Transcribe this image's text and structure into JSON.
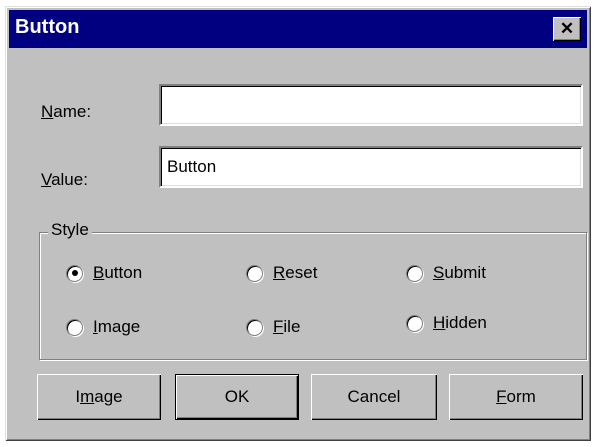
{
  "window": {
    "title": "Button",
    "close_glyph": "✕"
  },
  "form": {
    "name_label_mnemonic": "N",
    "name_label_rest": "ame:",
    "name_value": "",
    "value_label_mnemonic": "V",
    "value_label_rest": "alue:",
    "value_value": "Button"
  },
  "style_group": {
    "legend": "Style",
    "options": [
      {
        "mnemonic": "B",
        "rest": "utton",
        "selected": true
      },
      {
        "mnemonic": "R",
        "rest": "eset",
        "selected": false
      },
      {
        "mnemonic": "S",
        "rest": "ubmit",
        "selected": false
      },
      {
        "mnemonic": "I",
        "rest": "mage",
        "selected": false
      },
      {
        "mnemonic": "F",
        "rest": "ile",
        "selected": false
      },
      {
        "mnemonic": "H",
        "rest": "idden",
        "selected": false
      }
    ]
  },
  "buttons": {
    "image_pre": "I",
    "image_mnemonic": "m",
    "image_post": "age",
    "ok": "OK",
    "cancel": "Cancel",
    "form_mnemonic": "F",
    "form_rest": "orm"
  },
  "colors": {
    "titlebar": "#000080",
    "face": "#c0c0c0"
  }
}
